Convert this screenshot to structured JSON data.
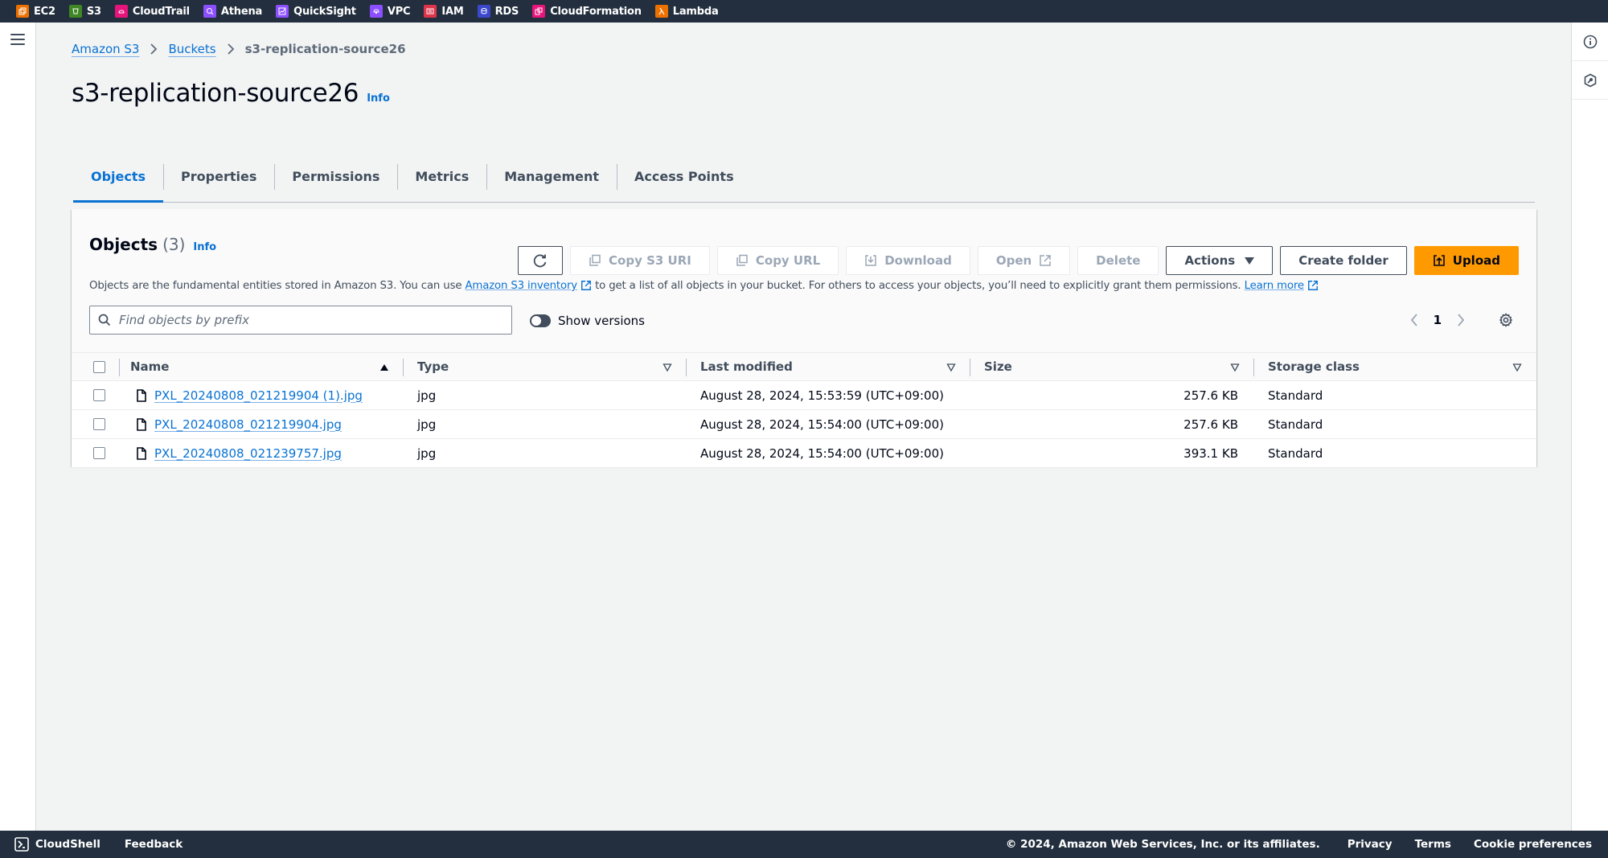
{
  "topnav": {
    "services": [
      {
        "label": "EC2",
        "icon": "ec2-icon",
        "color": "#ed7100"
      },
      {
        "label": "S3",
        "icon": "s3-icon",
        "color": "#3f8624"
      },
      {
        "label": "CloudTrail",
        "icon": "cloudtrail-icon",
        "color": "#e7157b"
      },
      {
        "label": "Athena",
        "icon": "athena-icon",
        "color": "#8c4fff"
      },
      {
        "label": "QuickSight",
        "icon": "quicksight-icon",
        "color": "#8c4fff"
      },
      {
        "label": "VPC",
        "icon": "vpc-icon",
        "color": "#8c4fff"
      },
      {
        "label": "IAM",
        "icon": "iam-icon",
        "color": "#dd344c"
      },
      {
        "label": "RDS",
        "icon": "rds-icon",
        "color": "#3b48cc"
      },
      {
        "label": "CloudFormation",
        "icon": "cloudformation-icon",
        "color": "#e7157b"
      },
      {
        "label": "Lambda",
        "icon": "lambda-icon",
        "color": "#ed7100"
      }
    ]
  },
  "breadcrumb": {
    "items": [
      "Amazon S3",
      "Buckets"
    ],
    "current": "s3-replication-source26"
  },
  "page": {
    "title": "s3-replication-source26",
    "info": "Info"
  },
  "tabs": [
    {
      "label": "Objects",
      "active": true
    },
    {
      "label": "Properties"
    },
    {
      "label": "Permissions"
    },
    {
      "label": "Metrics"
    },
    {
      "label": "Management"
    },
    {
      "label": "Access Points"
    }
  ],
  "objects": {
    "title": "Objects",
    "count": "(3)",
    "info": "Info",
    "description": {
      "prefix": "Objects are the fundamental entities stored in Amazon S3. You can use ",
      "inventory_link": "Amazon S3 inventory",
      "middle": " to get a list of all objects in your bucket. For others to access your objects, you’ll need to explicitly grant them permissions. ",
      "learn_more": "Learn more"
    },
    "buttons": {
      "copy_s3_uri": "Copy S3 URI",
      "copy_url": "Copy URL",
      "download": "Download",
      "open": "Open",
      "delete": "Delete",
      "actions": "Actions",
      "create_folder": "Create folder",
      "upload": "Upload"
    },
    "search": {
      "placeholder": "Find objects by prefix",
      "value": ""
    },
    "show_versions": {
      "label": "Show versions",
      "enabled": false
    },
    "pagination": {
      "current_page": "1"
    },
    "columns": [
      "Name",
      "Type",
      "Last modified",
      "Size",
      "Storage class"
    ],
    "rows": [
      {
        "name": "PXL_20240808_021219904 (1).jpg",
        "type": "jpg",
        "last_modified": "August 28, 2024, 15:53:59 (UTC+09:00)",
        "size": "257.6 KB",
        "storage_class": "Standard"
      },
      {
        "name": "PXL_20240808_021219904.jpg",
        "type": "jpg",
        "last_modified": "August 28, 2024, 15:54:00 (UTC+09:00)",
        "size": "257.6 KB",
        "storage_class": "Standard"
      },
      {
        "name": "PXL_20240808_021239757.jpg",
        "type": "jpg",
        "last_modified": "August 28, 2024, 15:54:00 (UTC+09:00)",
        "size": "393.1 KB",
        "storage_class": "Standard"
      }
    ]
  },
  "footer": {
    "cloudshell": "CloudShell",
    "feedback": "Feedback",
    "copyright": "© 2024, Amazon Web Services, Inc. or its affiliates.",
    "links": [
      "Privacy",
      "Terms",
      "Cookie preferences"
    ]
  },
  "colors": {
    "nav_bg": "#232f3e",
    "link": "#0972d3",
    "primary_button": "#ff9900"
  }
}
